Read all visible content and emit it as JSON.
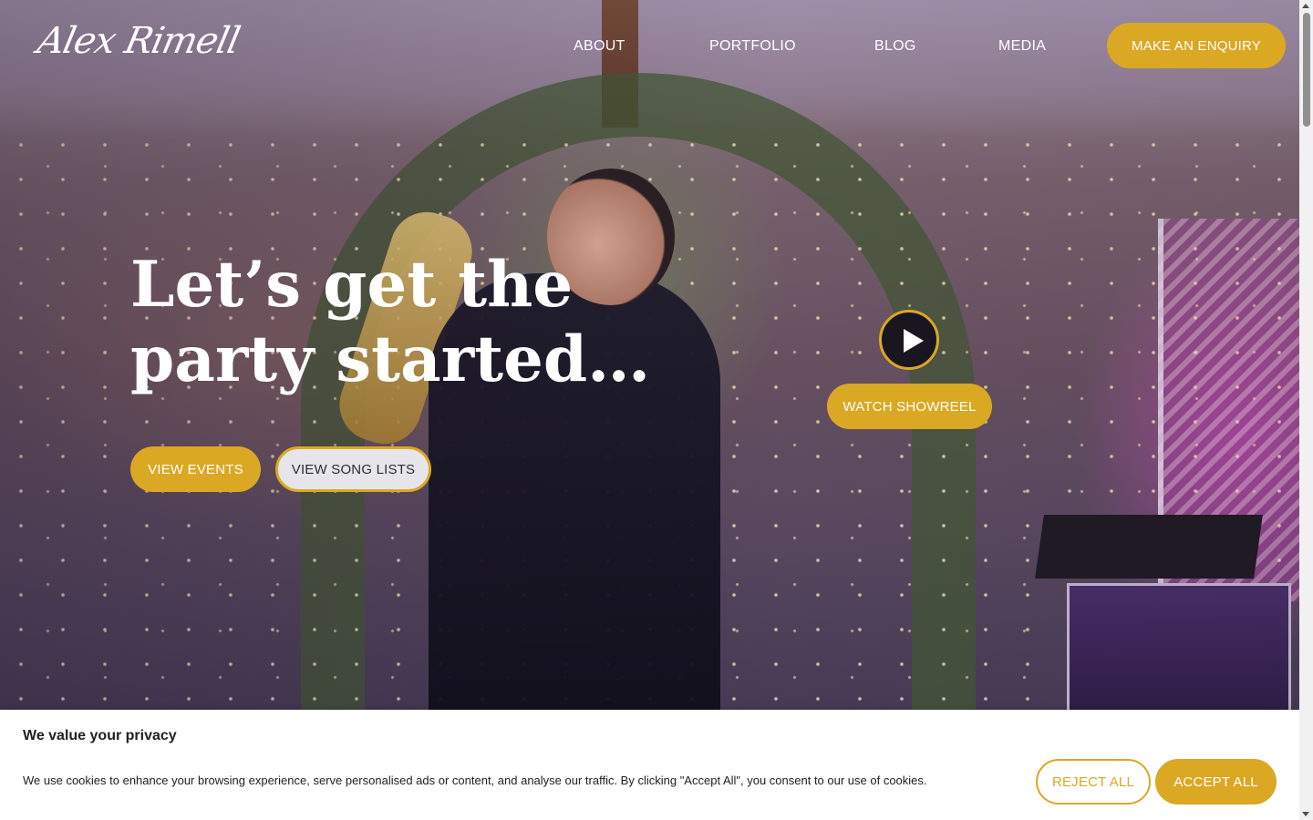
{
  "header": {
    "logo_text": "Alex Rimell",
    "nav": {
      "about": "ABOUT",
      "portfolio": "PORTFOLIO",
      "blog": "BLOG",
      "media": "MEDIA"
    },
    "enquiry_label": "MAKE AN ENQUIRY"
  },
  "hero": {
    "headline_line1": "Let’s get the",
    "headline_line2": "party started…",
    "view_events_label": "VIEW EVENTS",
    "view_song_lists_label": "VIEW SONG LISTS",
    "watch_showreel_label": "WATCH SHOWREEL",
    "play_icon": "play-icon"
  },
  "cookie_banner": {
    "title": "We value your privacy",
    "text": "We use cookies to enhance your browsing experience, serve personalised ads or content, and analyse our traffic. By clicking \"Accept All\", you consent to our use of cookies.",
    "reject_label": "REJECT ALL",
    "accept_label": "ACCEPT ALL"
  },
  "colors": {
    "accent": "#dba823",
    "button_light": "#e6e6ea",
    "text_dark": "#212121"
  }
}
